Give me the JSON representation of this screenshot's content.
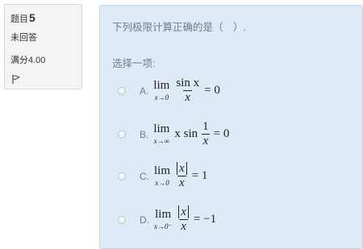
{
  "question_info": {
    "label": "题目",
    "number": "5",
    "status": "未回答",
    "grade": "满分4.00",
    "flag_icon": "flag-outline-icon"
  },
  "question": {
    "text": "下列极限计算正确的是（　）.",
    "prompt": "选择一项:"
  },
  "options": [
    {
      "letter": "A.",
      "lim_word": "lim",
      "lim_sub": "x→0",
      "num": "sin x",
      "den": "x",
      "rhs": "= 0"
    },
    {
      "letter": "B.",
      "lim_word": "lim",
      "lim_sub": "x→∞",
      "pre": "x sin",
      "num": "1",
      "den": "x",
      "rhs": "= 0"
    },
    {
      "letter": "C.",
      "lim_word": "lim",
      "lim_sub": "x→0",
      "num": "x",
      "den": "x",
      "rhs": "= 1"
    },
    {
      "letter": "D.",
      "lim_word": "lim",
      "lim_sub": "x→0⁻",
      "num": "x",
      "den": "x",
      "rhs": "= −1"
    }
  ],
  "colors": {
    "content_bg": "#deebf6",
    "info_bg": "#f4f4f4",
    "text": "#6b7d8c"
  }
}
